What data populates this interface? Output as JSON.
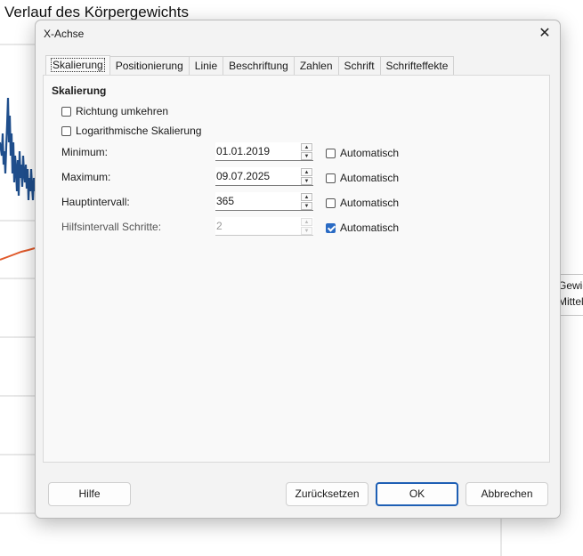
{
  "background": {
    "chart_title": "Verlauf des Körpergewichts",
    "legend": [
      "Gewic",
      "Mittel"
    ],
    "colors": {
      "series_weight": "#1f4e8c",
      "series_average": "#e0592a"
    }
  },
  "dialog": {
    "title": "X-Achse",
    "close_icon": "✕",
    "tabs": [
      {
        "label": "Skalierung",
        "active": true
      },
      {
        "label": "Positionierung",
        "active": false
      },
      {
        "label": "Linie",
        "active": false
      },
      {
        "label": "Beschriftung",
        "active": false
      },
      {
        "label": "Zahlen",
        "active": false
      },
      {
        "label": "Schrift",
        "active": false
      },
      {
        "label": "Schrifteffekte",
        "active": false
      }
    ],
    "section_title": "Skalierung",
    "checkbox_reverse": {
      "label": "Richtung umkehren",
      "checked": false
    },
    "checkbox_log": {
      "label": "Logarithmische Skalierung",
      "checked": false
    },
    "fields": {
      "minimum": {
        "label": "Minimum:",
        "value": "01.01.2019",
        "auto_label": "Automatisch",
        "auto_checked": false
      },
      "maximum": {
        "label": "Maximum:",
        "value": "09.07.2025",
        "auto_label": "Automatisch",
        "auto_checked": false
      },
      "major": {
        "label": "Hauptintervall:",
        "value": "365",
        "auto_label": "Automatisch",
        "auto_checked": false
      },
      "minor": {
        "label": "Hilfsintervall Schritte:",
        "value": "2",
        "auto_label": "Automatisch",
        "auto_checked": true,
        "disabled": true
      }
    },
    "buttons": {
      "help": "Hilfe",
      "reset": "Zurücksetzen",
      "ok": "OK",
      "cancel": "Abbrechen"
    },
    "accent_color": "#1e5fb4"
  }
}
